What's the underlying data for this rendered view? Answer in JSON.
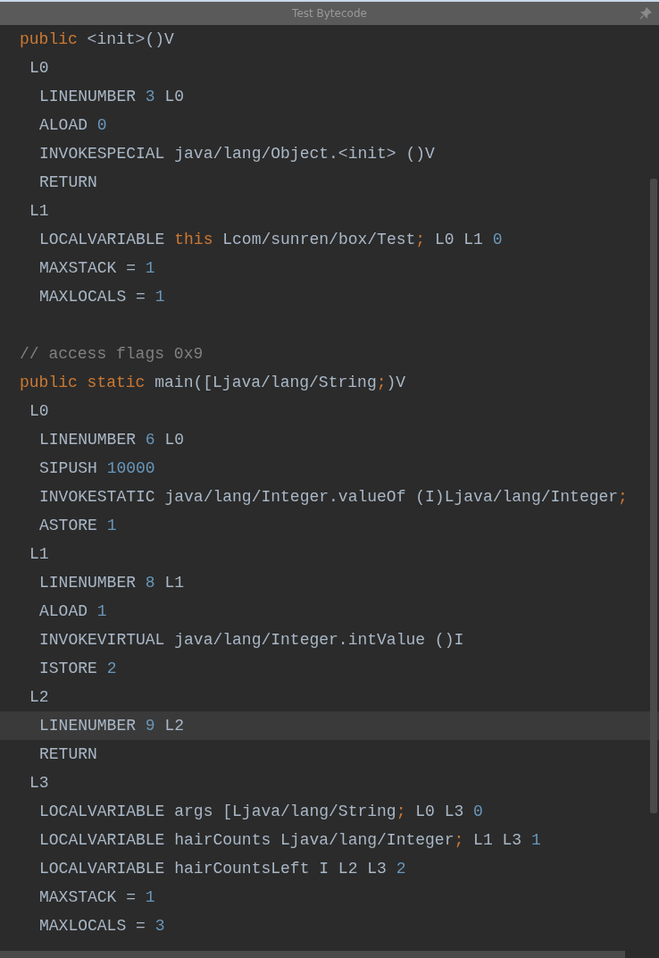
{
  "window": {
    "title": "Test Bytecode"
  },
  "methods": [
    {
      "lines": [
        {
          "current": false,
          "tokens": [
            {
              "text": "public",
              "kind": "keyword"
            },
            {
              "text": " <init>()V",
              "kind": "plain"
            }
          ],
          "children": [
            {
              "current": false,
              "tokens": [
                {
                  "text": "L0",
                  "kind": "plain"
                }
              ],
              "children": [
                {
                  "current": false,
                  "tokens": [
                    {
                      "text": "LINENUMBER ",
                      "kind": "plain"
                    },
                    {
                      "text": "3",
                      "kind": "number"
                    },
                    {
                      "text": " L0",
                      "kind": "plain"
                    }
                  ]
                },
                {
                  "current": false,
                  "tokens": [
                    {
                      "text": "ALOAD ",
                      "kind": "plain"
                    },
                    {
                      "text": "0",
                      "kind": "number"
                    }
                  ]
                },
                {
                  "current": false,
                  "tokens": [
                    {
                      "text": "INVOKESPECIAL java/lang/Object.<init> ()V",
                      "kind": "plain"
                    }
                  ]
                },
                {
                  "current": false,
                  "tokens": [
                    {
                      "text": "RETURN",
                      "kind": "plain"
                    }
                  ]
                }
              ]
            },
            {
              "current": false,
              "tokens": [
                {
                  "text": "L1",
                  "kind": "plain"
                }
              ],
              "children": [
                {
                  "current": false,
                  "tokens": [
                    {
                      "text": "LOCALVARIABLE ",
                      "kind": "plain"
                    },
                    {
                      "text": "this",
                      "kind": "keyword"
                    },
                    {
                      "text": " Lcom/sunren/box/Test",
                      "kind": "plain"
                    },
                    {
                      "text": ";",
                      "kind": "keyword"
                    },
                    {
                      "text": " L0 L1 ",
                      "kind": "plain"
                    },
                    {
                      "text": "0",
                      "kind": "number"
                    }
                  ]
                },
                {
                  "current": false,
                  "tokens": [
                    {
                      "text": "MAXSTACK = ",
                      "kind": "plain"
                    },
                    {
                      "text": "1",
                      "kind": "number"
                    }
                  ]
                },
                {
                  "current": false,
                  "tokens": [
                    {
                      "text": "MAXLOCALS = ",
                      "kind": "plain"
                    },
                    {
                      "text": "1",
                      "kind": "number"
                    }
                  ]
                }
              ]
            }
          ]
        }
      ]
    },
    {
      "lines": [
        {
          "current": false,
          "tokens": [
            {
              "text": "// access flags 0x9",
              "kind": "comment"
            }
          ]
        },
        {
          "current": false,
          "tokens": [
            {
              "text": "public",
              "kind": "keyword"
            },
            {
              "text": " static",
              "kind": "keyword"
            },
            {
              "text": " main([Ljava/lang/String",
              "kind": "plain"
            },
            {
              "text": ";",
              "kind": "keyword"
            },
            {
              "text": ")V",
              "kind": "plain"
            }
          ],
          "children": [
            {
              "current": false,
              "tokens": [
                {
                  "text": "L0",
                  "kind": "plain"
                }
              ],
              "children": [
                {
                  "current": false,
                  "tokens": [
                    {
                      "text": "LINENUMBER ",
                      "kind": "plain"
                    },
                    {
                      "text": "6",
                      "kind": "number"
                    },
                    {
                      "text": " L0",
                      "kind": "plain"
                    }
                  ]
                },
                {
                  "current": false,
                  "tokens": [
                    {
                      "text": "SIPUSH ",
                      "kind": "plain"
                    },
                    {
                      "text": "10000",
                      "kind": "number"
                    }
                  ]
                },
                {
                  "current": false,
                  "tokens": [
                    {
                      "text": "INVOKESTATIC java/lang/Integer.valueOf (I)Ljava/lang/Integer",
                      "kind": "plain"
                    },
                    {
                      "text": ";",
                      "kind": "keyword"
                    }
                  ]
                },
                {
                  "current": false,
                  "tokens": [
                    {
                      "text": "ASTORE ",
                      "kind": "plain"
                    },
                    {
                      "text": "1",
                      "kind": "number"
                    }
                  ]
                }
              ]
            },
            {
              "current": false,
              "tokens": [
                {
                  "text": "L1",
                  "kind": "plain"
                }
              ],
              "children": [
                {
                  "current": false,
                  "tokens": [
                    {
                      "text": "LINENUMBER ",
                      "kind": "plain"
                    },
                    {
                      "text": "8",
                      "kind": "number"
                    },
                    {
                      "text": " L1",
                      "kind": "plain"
                    }
                  ]
                },
                {
                  "current": false,
                  "tokens": [
                    {
                      "text": "ALOAD ",
                      "kind": "plain"
                    },
                    {
                      "text": "1",
                      "kind": "number"
                    }
                  ]
                },
                {
                  "current": false,
                  "tokens": [
                    {
                      "text": "INVOKEVIRTUAL java/lang/Integer.intValue ()I",
                      "kind": "plain"
                    }
                  ]
                },
                {
                  "current": false,
                  "tokens": [
                    {
                      "text": "ISTORE ",
                      "kind": "plain"
                    },
                    {
                      "text": "2",
                      "kind": "number"
                    }
                  ]
                }
              ]
            },
            {
              "current": false,
              "tokens": [
                {
                  "text": "L2",
                  "kind": "plain"
                }
              ],
              "children": [
                {
                  "current": true,
                  "tokens": [
                    {
                      "text": "LINENUMBER ",
                      "kind": "plain"
                    },
                    {
                      "text": "9",
                      "kind": "number"
                    },
                    {
                      "text": " L2",
                      "kind": "plain"
                    }
                  ]
                },
                {
                  "current": false,
                  "tokens": [
                    {
                      "text": "RETURN",
                      "kind": "plain"
                    }
                  ]
                }
              ]
            },
            {
              "current": false,
              "tokens": [
                {
                  "text": "L3",
                  "kind": "plain"
                }
              ],
              "children": [
                {
                  "current": false,
                  "tokens": [
                    {
                      "text": "LOCALVARIABLE args [Ljava/lang/String",
                      "kind": "plain"
                    },
                    {
                      "text": ";",
                      "kind": "keyword"
                    },
                    {
                      "text": " L0 L3 ",
                      "kind": "plain"
                    },
                    {
                      "text": "0",
                      "kind": "number"
                    }
                  ]
                },
                {
                  "current": false,
                  "tokens": [
                    {
                      "text": "LOCALVARIABLE hairCounts Ljava/lang/Integer",
                      "kind": "plain"
                    },
                    {
                      "text": ";",
                      "kind": "keyword"
                    },
                    {
                      "text": " L1 L3 ",
                      "kind": "plain"
                    },
                    {
                      "text": "1",
                      "kind": "number"
                    }
                  ]
                },
                {
                  "current": false,
                  "tokens": [
                    {
                      "text": "LOCALVARIABLE hairCountsLeft I L2 L3 ",
                      "kind": "plain"
                    },
                    {
                      "text": "2",
                      "kind": "number"
                    }
                  ]
                },
                {
                  "current": false,
                  "tokens": [
                    {
                      "text": "MAXSTACK = ",
                      "kind": "plain"
                    },
                    {
                      "text": "1",
                      "kind": "number"
                    }
                  ]
                },
                {
                  "current": false,
                  "tokens": [
                    {
                      "text": "MAXLOCALS = ",
                      "kind": "plain"
                    },
                    {
                      "text": "3",
                      "kind": "number"
                    }
                  ]
                }
              ]
            }
          ]
        }
      ]
    }
  ]
}
